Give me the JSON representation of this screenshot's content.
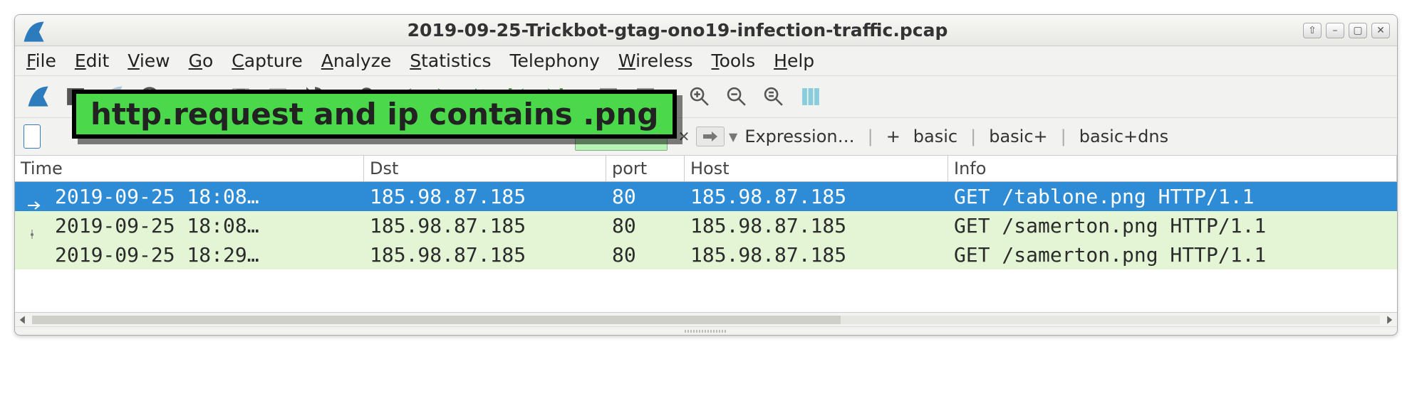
{
  "window": {
    "title": "2019-09-25-Trickbot-gtag-ono19-infection-traffic.pcap"
  },
  "menu": {
    "items": [
      {
        "label": "File",
        "ul": "F"
      },
      {
        "label": "Edit",
        "ul": "E"
      },
      {
        "label": "View",
        "ul": "V"
      },
      {
        "label": "Go",
        "ul": "G"
      },
      {
        "label": "Capture",
        "ul": "C"
      },
      {
        "label": "Analyze",
        "ul": "A"
      },
      {
        "label": "Statistics",
        "ul": "S"
      },
      {
        "label": "Telephony",
        "ul": ""
      },
      {
        "label": "Wireless",
        "ul": "W"
      },
      {
        "label": "Tools",
        "ul": "T"
      },
      {
        "label": "Help",
        "ul": "H"
      }
    ]
  },
  "filter_highlight": "http.request and ip contains .png",
  "expression": {
    "label": "Expression…",
    "plus": "+",
    "basic": "basic",
    "basic_plus": "basic+",
    "basic_dns": "basic+dns"
  },
  "columns": {
    "time": "Time",
    "dst": "Dst",
    "port": "port",
    "host": "Host",
    "info": "Info"
  },
  "rows": [
    {
      "time": "2019-09-25 18:08…",
      "dst": "185.98.87.185",
      "port": "80",
      "host": "185.98.87.185",
      "info": "GET /tablone.png HTTP/1.1",
      "selected": true
    },
    {
      "time": "2019-09-25 18:08…",
      "dst": "185.98.87.185",
      "port": "80",
      "host": "185.98.87.185",
      "info": "GET /samerton.png HTTP/1.1",
      "selected": false
    },
    {
      "time": "2019-09-25 18:29…",
      "dst": "185.98.87.185",
      "port": "80",
      "host": "185.98.87.185",
      "info": "GET /samerton.png HTTP/1.1",
      "selected": false
    }
  ]
}
